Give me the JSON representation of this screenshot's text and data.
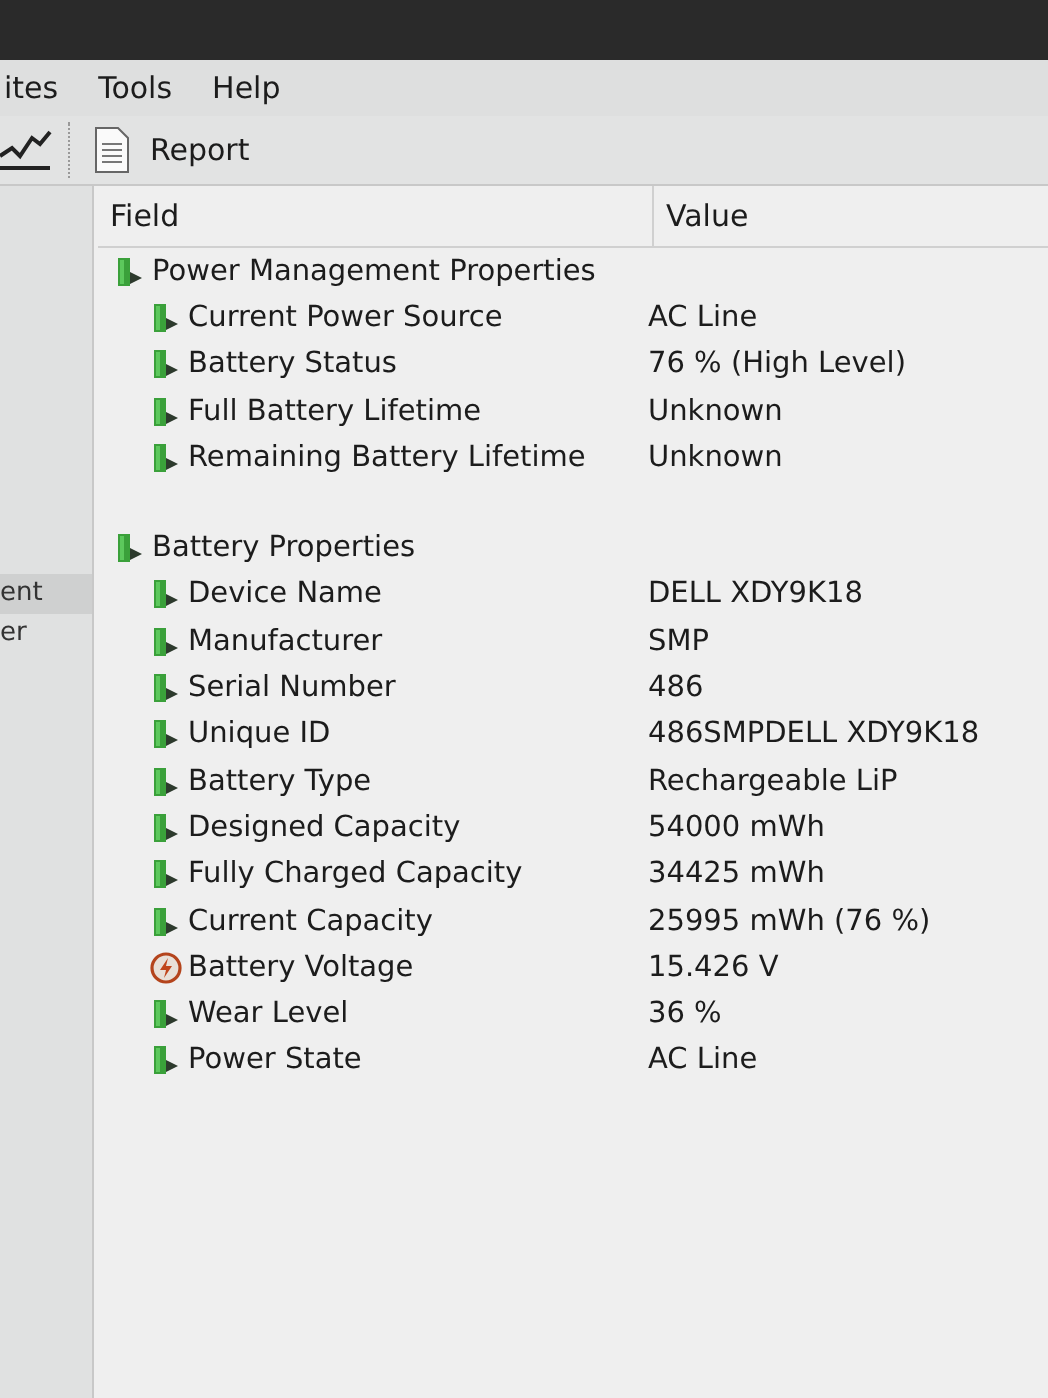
{
  "menu": [
    "ites",
    "Tools",
    "Help"
  ],
  "toolbar": {
    "report_label": "Report"
  },
  "sidebar": {
    "items": [
      {
        "label": "ent",
        "selected": true
      },
      {
        "label": "er",
        "selected": false
      }
    ]
  },
  "table": {
    "columns": [
      "Field",
      "Value"
    ],
    "groups": [
      {
        "label": "Power Management Properties",
        "children": [
          {
            "field": "Current Power Source",
            "value": "AC Line",
            "kind": "battery"
          },
          {
            "field": "Battery Status",
            "value": "76 % (High Level)",
            "kind": "battery"
          },
          {
            "field": "Full Battery Lifetime",
            "value": "Unknown",
            "kind": "battery"
          },
          {
            "field": "Remaining Battery Lifetime",
            "value": "Unknown",
            "kind": "battery"
          }
        ]
      },
      {
        "label": "Battery Properties",
        "children": [
          {
            "field": "Device Name",
            "value": "DELL XDY9K18",
            "kind": "battery"
          },
          {
            "field": "Manufacturer",
            "value": "SMP",
            "kind": "battery"
          },
          {
            "field": "Serial Number",
            "value": "486",
            "kind": "battery"
          },
          {
            "field": "Unique ID",
            "value": "486SMPDELL XDY9K18",
            "kind": "battery"
          },
          {
            "field": "Battery Type",
            "value": "Rechargeable LiP",
            "kind": "battery"
          },
          {
            "field": "Designed Capacity",
            "value": "54000 mWh",
            "kind": "battery"
          },
          {
            "field": "Fully Charged Capacity",
            "value": "34425 mWh",
            "kind": "battery"
          },
          {
            "field": "Current Capacity",
            "value": "25995 mWh  (76 %)",
            "kind": "battery"
          },
          {
            "field": "Battery Voltage",
            "value": "15.426 V",
            "kind": "voltage"
          },
          {
            "field": "Wear Level",
            "value": "36 %",
            "kind": "battery"
          },
          {
            "field": "Power State",
            "value": "AC Line",
            "kind": "battery"
          }
        ]
      }
    ]
  }
}
